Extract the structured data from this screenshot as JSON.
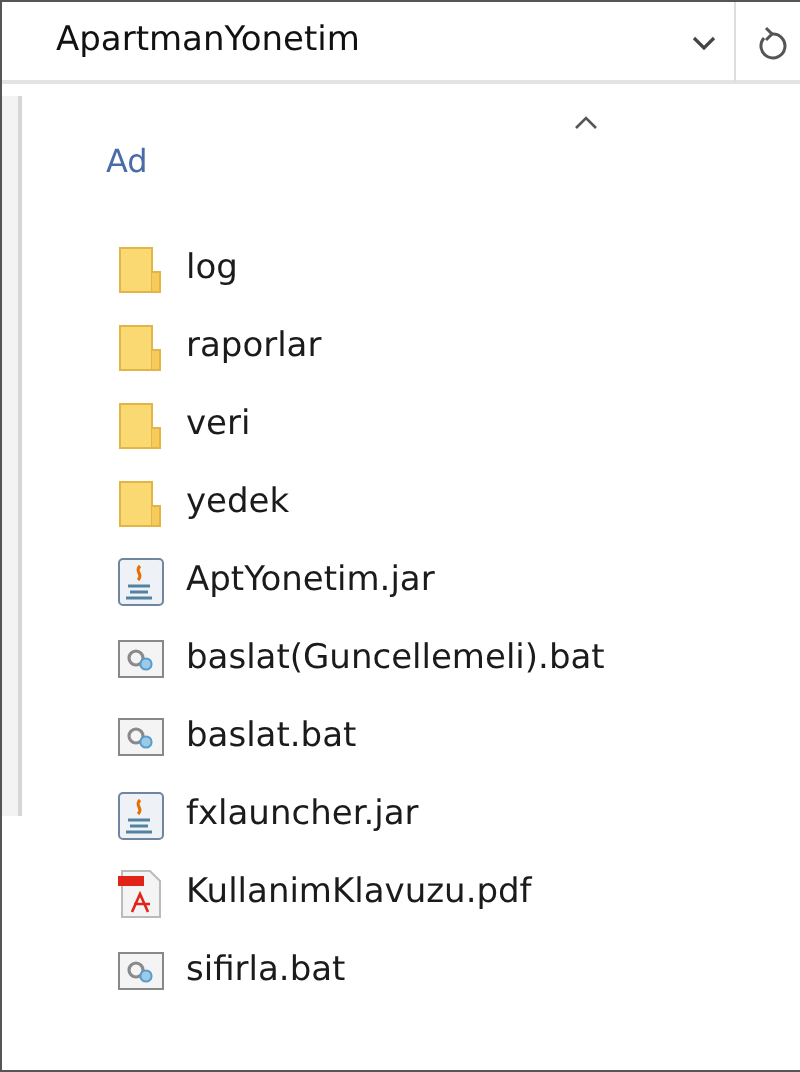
{
  "address_bar": {
    "path": "ApartmanYonetim"
  },
  "column_header": {
    "label": "Ad",
    "sorted_ascending": true
  },
  "files": [
    {
      "name": "log",
      "kind": "folder"
    },
    {
      "name": "raporlar",
      "kind": "folder"
    },
    {
      "name": "veri",
      "kind": "folder"
    },
    {
      "name": "yedek",
      "kind": "folder"
    },
    {
      "name": "AptYonetim.jar",
      "kind": "jar"
    },
    {
      "name": "baslat(Guncellemeli).bat",
      "kind": "bat"
    },
    {
      "name": "baslat.bat",
      "kind": "bat"
    },
    {
      "name": "fxlauncher.jar",
      "kind": "jar"
    },
    {
      "name": "KullanimKlavuzu.pdf",
      "kind": "pdf"
    },
    {
      "name": "sifirla.bat",
      "kind": "bat"
    }
  ]
}
